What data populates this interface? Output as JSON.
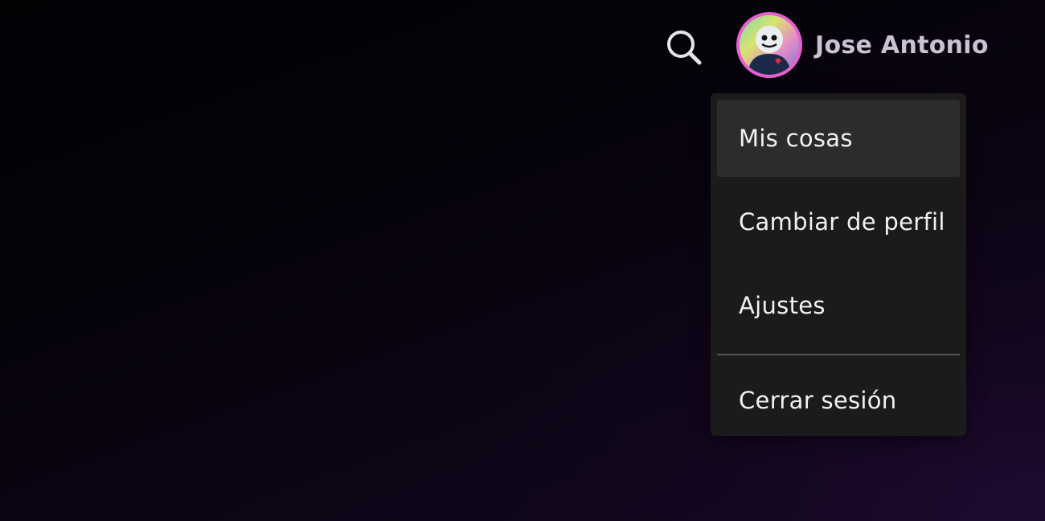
{
  "header": {
    "search_icon": "search-icon",
    "profile": {
      "name": "Jose Antonio",
      "avatar_ring_color": "#e85fd0"
    }
  },
  "menu": {
    "items": [
      {
        "label": "Mis cosas",
        "selected": true
      },
      {
        "label": "Cambiar de perfil",
        "selected": false
      },
      {
        "label": "Ajustes",
        "selected": false
      }
    ],
    "logout_label": "Cerrar sesión"
  }
}
